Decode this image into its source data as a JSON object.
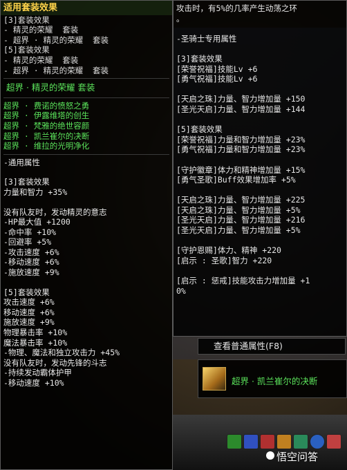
{
  "left_panel": {
    "title": "适用套装效果",
    "summary_lines": [
      "[3]套装效果",
      "- 精灵的荣耀  套装",
      "- 超界 · 精灵的荣耀  套装",
      "[5]套装效果",
      "- 精灵的荣耀  套装",
      "- 超界 · 精灵的荣耀  套装"
    ],
    "set_title": "超界 · 精灵的荣耀  套装",
    "set_items": [
      "超界 · 费诺的愤怒之勇",
      "超界 · 伊露维塔的创生",
      "超界 · 梵雅的绝世容颜",
      "超界 · 凯兰崔尔的决断",
      "超界 · 维拉的光明净化"
    ],
    "common_header": "-通用属性",
    "set3_lines": [
      "[3]套装效果",
      "力量和智力 +35%"
    ],
    "spirit_lines": [
      "没有队友时，发动精灵的意志",
      "-HP最大值 +1200",
      "-命中率 +10%",
      "-回避率 +5%",
      "-攻击速度 +6%",
      "-移动速度 +6%",
      "-施放速度 +9%"
    ],
    "set5_lines": [
      "[5]套装效果",
      "攻击速度 +6%",
      "移动速度 +6%",
      "施放速度 +9%",
      "物理暴击率 +10%",
      "魔法暴击率 +10%",
      "-物理、魔法和独立攻击力 +45%",
      "没有队友时，发动先锋的斗志",
      "-持续发动霸体护甲",
      "-移动速度 +10%"
    ]
  },
  "right_panel": {
    "lines": [
      "攻击时，有5%的几率产生动荡之环",
      "。",
      "",
      "-圣骑士专用属性",
      "",
      "[3]套装效果",
      "[荣誉祝福]技能Lv +6",
      "[勇气祝福]技能Lv +6",
      "",
      "[天启之珠]力量、智力增加量 +150",
      "[圣光天启]力量、智力增加量 +144",
      "",
      "[5]套装效果",
      "[荣誉祝福]力量和智力增加量 +23%",
      "[勇气祝福]力量和智力增加量 +23%",
      "",
      "[守护徽章]体力和精神增加量 +15%",
      "[勇气圣歌]Buff效果增加率 +5%",
      "",
      "[天启之珠]力量、智力增加量 +225",
      "[天启之珠]力量、智力增加量 +5%",
      "[圣光天启]力量、智力增加量 +216",
      "[圣光天启]力量、智力增加量 +5%",
      "",
      "[守护恩赐]体力、精神 +220",
      "[启示 : 圣歌]智力 +220",
      "",
      "[启示 : 惩戒]技能攻击力增加量 +1",
      "0%"
    ]
  },
  "view_button": {
    "label": "查看普通属性(F8)"
  },
  "equipped_item": {
    "name": "超界 · 凯兰崔尔的决断",
    "icon": "item-icon"
  },
  "watermark": {
    "text": "悟空问答"
  },
  "colors": {
    "title": "#ffd34a",
    "green": "#5be35b",
    "text": "#dcdcdc",
    "panel_bg": "#000000"
  }
}
